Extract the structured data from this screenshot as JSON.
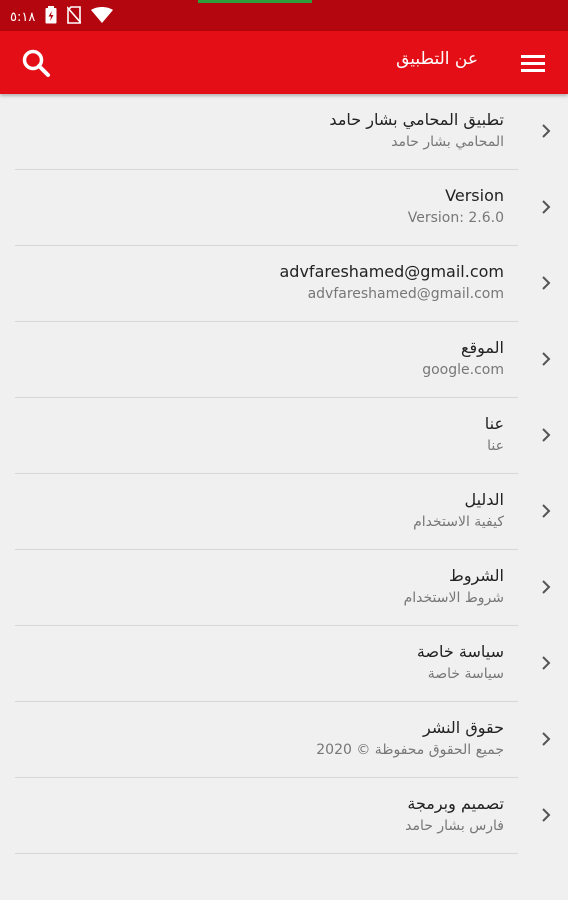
{
  "colors": {
    "status_bar": "#b3060e",
    "app_bar": "#e30e16",
    "background": "#f0f0f0",
    "title_text": "#222222",
    "subtitle_text": "#777777"
  },
  "status_bar": {
    "time": "٥:١٨",
    "icons": [
      "battery-icon",
      "no-sim-icon",
      "wifi-icon"
    ]
  },
  "app_bar": {
    "title": "عن التطبيق",
    "search_icon": "search-icon",
    "menu_icon": "menu-icon"
  },
  "items": [
    {
      "title": "تطبيق المحامي بشار حامد",
      "subtitle": "المحامي بشار حامد"
    },
    {
      "title": "Version",
      "subtitle": "Version: 2.6.0"
    },
    {
      "title": "advfareshamed@gmail.com",
      "subtitle": "advfareshamed@gmail.com"
    },
    {
      "title": "الموقع",
      "subtitle": "google.com"
    },
    {
      "title": "عنا",
      "subtitle": "عنا"
    },
    {
      "title": "الدليل",
      "subtitle": "كيفية الاستخدام"
    },
    {
      "title": "الشروط",
      "subtitle": "شروط الاستخدام"
    },
    {
      "title": "سياسة خاصة",
      "subtitle": "سياسة خاصة"
    },
    {
      "title": "حقوق النشر",
      "subtitle": "جميع الحقوق محفوظة © 2020"
    },
    {
      "title": "تصميم وبرمجة",
      "subtitle": "فارس بشار حامد"
    }
  ]
}
